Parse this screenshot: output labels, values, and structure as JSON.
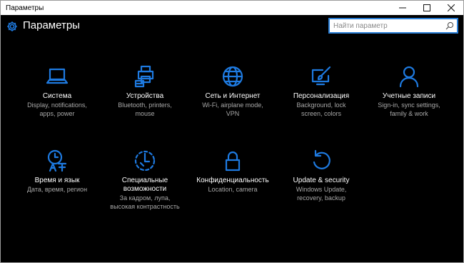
{
  "window": {
    "title": "Параметры",
    "minimize_icon": "minimize-icon",
    "maximize_icon": "maximize-icon",
    "close_icon": "close-icon"
  },
  "header": {
    "title": "Параметры",
    "icon": "gear-icon",
    "accent_color": "#1e7ae0"
  },
  "search": {
    "placeholder": "Найти параметр",
    "value": "",
    "icon": "search-icon"
  },
  "tiles": [
    {
      "name": "Система",
      "desc_lines": [
        "Display, notifications,",
        "apps, power"
      ],
      "icon": "laptop-icon"
    },
    {
      "name": "Устройства",
      "desc_lines": [
        "Bluetooth, printers,",
        "mouse"
      ],
      "icon": "printer-keyboard-icon"
    },
    {
      "name": "Сеть и Интернет",
      "desc_lines": [
        "Wi-Fi, airplane mode,",
        "VPN"
      ],
      "icon": "globe-icon"
    },
    {
      "name": "Персонализация",
      "desc_lines": [
        "Background, lock",
        "screen, colors"
      ],
      "icon": "paintbrush-screen-icon"
    },
    {
      "name": "Учетные записи",
      "desc_lines": [
        "Sign-in, sync settings,",
        "family & work"
      ],
      "icon": "person-icon"
    },
    {
      "name": "Время и язык",
      "desc_lines": [
        "Дата, время, регион"
      ],
      "icon": "clock-language-icon"
    },
    {
      "name": "Специальные возможности",
      "name_lines": [
        "Специальные",
        "возможности"
      ],
      "desc_lines": [
        "За кадром, лупа,",
        "высокая контрастность"
      ],
      "icon": "ease-of-access-icon"
    },
    {
      "name": "Конфиденциальность",
      "desc_lines": [
        "Location, camera"
      ],
      "icon": "lock-icon"
    },
    {
      "name": "Update & security",
      "desc_lines": [
        "Windows Update,",
        "recovery, backup"
      ],
      "icon": "update-arrow-icon"
    }
  ]
}
